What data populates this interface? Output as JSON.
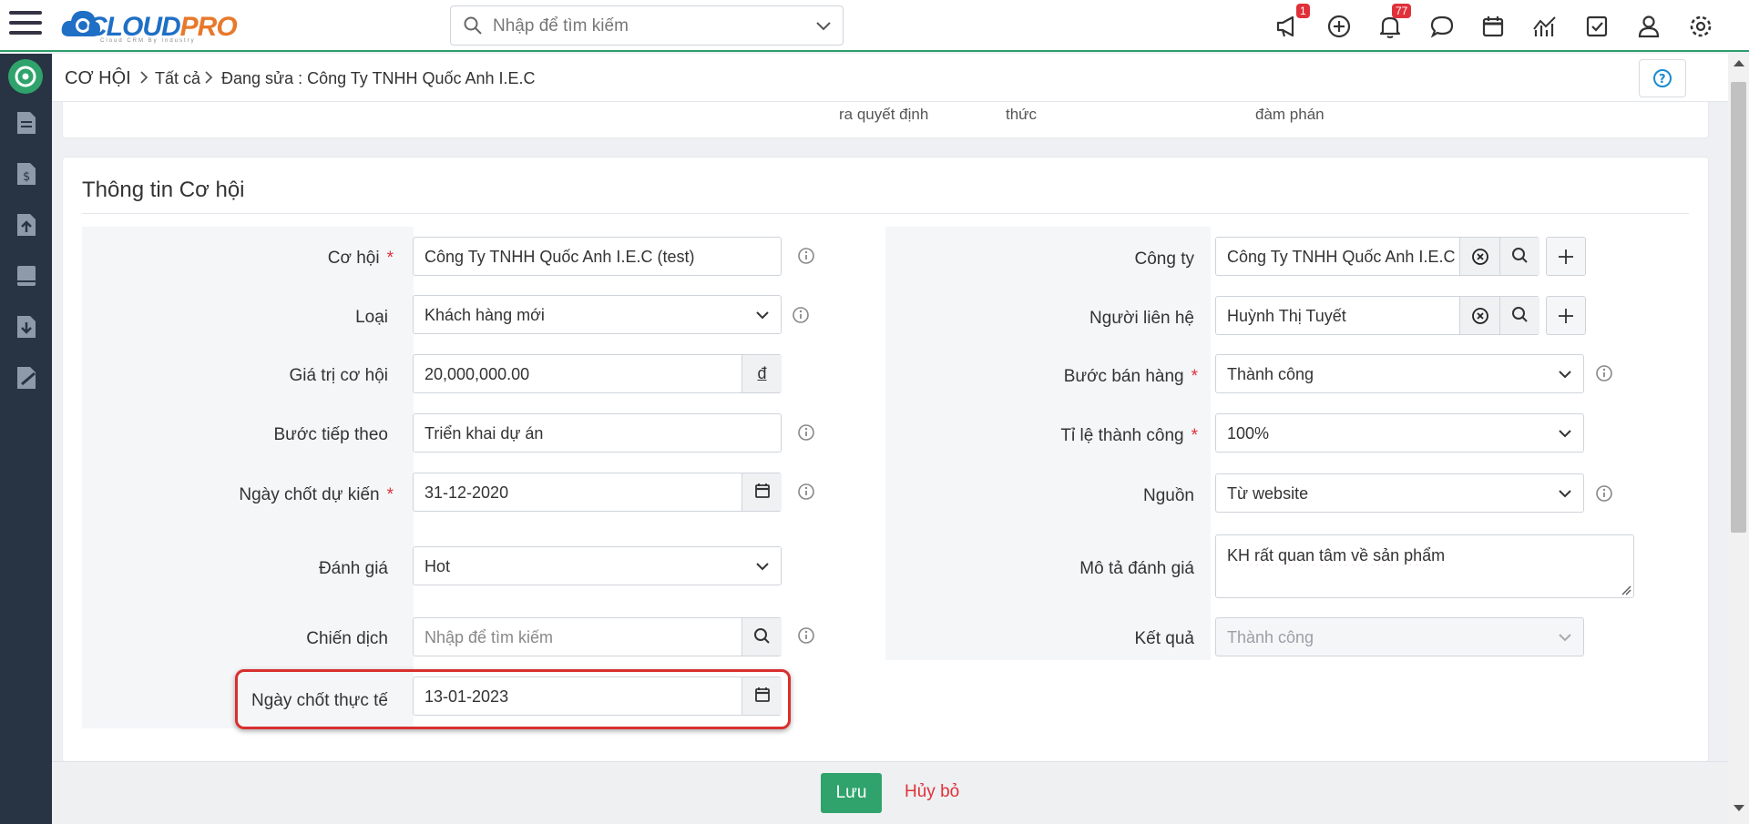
{
  "app": {
    "logo_text_blue": "CLOUD",
    "logo_text_orange": "PRO",
    "logo_tagline": "Cloud CRM By Industry",
    "search_placeholder": "Nhập để tìm kiếm",
    "notification_count_announce": "1",
    "notification_count_bell": "77"
  },
  "breadcrumb": {
    "module": "CƠ HỘI",
    "all": "Tất cả",
    "editing": "Đang sửa : Công Ty TNHH Quốc Anh I.E.C"
  },
  "prev_panel": {
    "texts": [
      "ra quyết định",
      "thức",
      "đàm phán"
    ]
  },
  "section": {
    "title": "Thông tin Cơ hội"
  },
  "left_fields": {
    "opportunity": {
      "label": "Cơ hội",
      "value": "Công Ty TNHH Quốc Anh I.E.C (test)"
    },
    "type": {
      "label": "Loại",
      "value": "Khách hàng mới"
    },
    "amount": {
      "label": "Giá trị cơ hội",
      "value": "20,000,000.00",
      "currency": "đ"
    },
    "next_step": {
      "label": "Bước tiếp theo",
      "value": "Triển khai dự án"
    },
    "expected_close": {
      "label": "Ngày chốt dự kiến",
      "value": "31-12-2020"
    },
    "rating": {
      "label": "Đánh giá",
      "value": "Hot"
    },
    "campaign": {
      "label": "Chiến dịch",
      "placeholder": "Nhập để tìm kiếm"
    },
    "actual_close": {
      "label": "Ngày chốt thực tế",
      "value": "13-01-2023"
    }
  },
  "right_fields": {
    "company": {
      "label": "Công ty",
      "value": "Công Ty TNHH Quốc Anh I.E.C"
    },
    "contact": {
      "label": "Người liên hệ",
      "value": "Huỳnh Thị Tuyết"
    },
    "sales_stage": {
      "label": "Bước bán hàng",
      "value": "Thành công"
    },
    "probability": {
      "label": "Tỉ lệ thành công",
      "value": "100%"
    },
    "source": {
      "label": "Nguồn",
      "value": "Từ website"
    },
    "rating_desc": {
      "label": "Mô tả đánh giá",
      "value": "KH rất quan tâm về sản phẩm"
    },
    "result": {
      "label": "Kết quả",
      "value": "Thành công"
    }
  },
  "footer": {
    "save": "Lưu",
    "cancel": "Hủy bỏ"
  },
  "colors": {
    "accent_green": "#2fa36b",
    "sidebar": "#283443",
    "danger_red": "#e0313a"
  }
}
